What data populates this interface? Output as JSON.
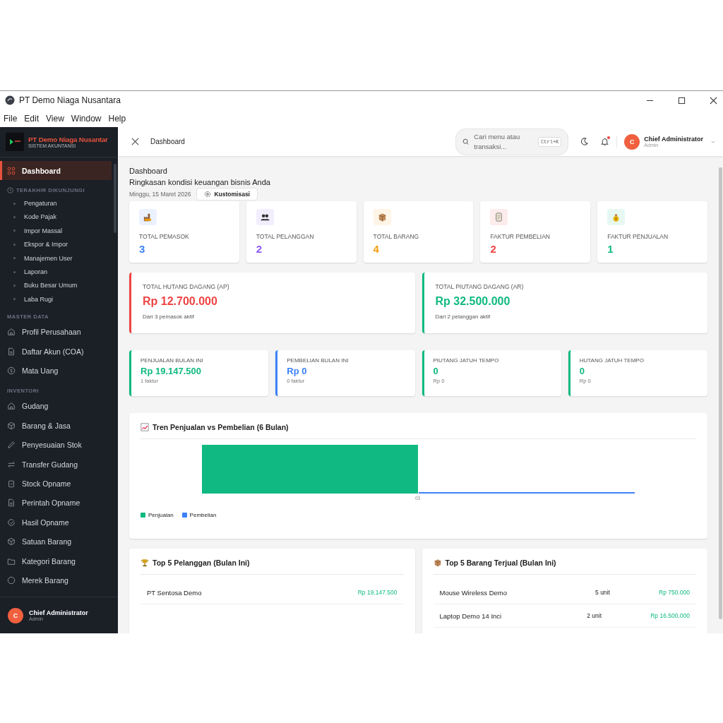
{
  "window": {
    "title": "PT Demo Niaga Nusantara"
  },
  "menu": [
    "File",
    "Edit",
    "View",
    "Window",
    "Help"
  ],
  "sidebar": {
    "brand": {
      "name": "PT Demo Niaga Nusantar",
      "subtitle": "SISTEM AKUNTANSI"
    },
    "nav": [
      {
        "kind": "item",
        "label": "Dashboard",
        "selected": true
      },
      {
        "kind": "section",
        "label": "TERAKHIR DIKUNJUNGI"
      },
      {
        "kind": "sub",
        "label": "Pengaturan",
        "selected": false
      },
      {
        "kind": "sub",
        "label": "Kode Pajak",
        "selected": false
      },
      {
        "kind": "sub",
        "label": "Impor Massal",
        "selected": false
      },
      {
        "kind": "sub",
        "label": "Ekspor & Impor",
        "selected": false
      },
      {
        "kind": "sub",
        "label": "Manajemen User",
        "selected": false
      },
      {
        "kind": "sub",
        "label": "Laporan",
        "selected": false
      },
      {
        "kind": "sub",
        "label": "Buku Besar Umum",
        "selected": false
      },
      {
        "kind": "sub",
        "label": "Laba Rugi",
        "selected": false
      },
      {
        "kind": "section",
        "label": "MASTER DATA"
      },
      {
        "kind": "item",
        "label": "Profil Perusahaan",
        "selected": false
      },
      {
        "kind": "item",
        "label": "Daftar Akun (COA)",
        "selected": false
      },
      {
        "kind": "item",
        "label": "Mata Uang",
        "selected": false
      },
      {
        "kind": "section",
        "label": "INVENTORI"
      },
      {
        "kind": "item",
        "label": "Gudang",
        "selected": false
      },
      {
        "kind": "item",
        "label": "Barang & Jasa",
        "selected": false
      },
      {
        "kind": "item",
        "label": "Penyesuaian Stok",
        "selected": false
      },
      {
        "kind": "item",
        "label": "Transfer Gudang",
        "selected": false
      },
      {
        "kind": "item",
        "label": "Stock Opname",
        "selected": false
      },
      {
        "kind": "item",
        "label": "Perintah Opname",
        "selected": false
      },
      {
        "kind": "item",
        "label": "Hasil Opname",
        "selected": false
      },
      {
        "kind": "item",
        "label": "Satuan Barang",
        "selected": false
      },
      {
        "kind": "item",
        "label": "Kategori Barang",
        "selected": false
      },
      {
        "kind": "item",
        "label": "Merek Barang",
        "selected": false
      }
    ],
    "user": {
      "initial": "C",
      "name": "Chief Administrator",
      "role": "Admin"
    }
  },
  "header": {
    "breadcrumb": "Dashboard",
    "search": {
      "placeholder": "Cari menu atau transaksi...",
      "shortcut": "Ctrl+K"
    },
    "notification_unread": true,
    "user": {
      "initial": "C",
      "name": "Chief Administrator",
      "role": "Admin"
    }
  },
  "page": {
    "title": "Dashboard",
    "subtitle": "Ringkasan kondisi keuangan bisnis Anda",
    "date": "Minggu, 15 Maret 2026",
    "customize_button": "Kustomisasi"
  },
  "stats": [
    {
      "label": "TOTAL PEMASOK",
      "value": "3",
      "color": "#3b82f6"
    },
    {
      "label": "TOTAL PELANGGAN",
      "value": "2",
      "color": "#8b5cf6"
    },
    {
      "label": "TOTAL BARANG",
      "value": "4",
      "color": "#f59e0b"
    },
    {
      "label": "FAKTUR PEMBELIAN",
      "value": "2",
      "color": "#ef4444"
    },
    {
      "label": "FAKTUR PENJUALAN",
      "value": "1",
      "color": "#10b981"
    }
  ],
  "balances": [
    {
      "label": "TOTAL HUTANG DAGANG (AP)",
      "value": "Rp 12.700.000",
      "note": "Dari 3 pemasok aktif",
      "color": "#ef4444"
    },
    {
      "label": "TOTAL PIUTANG DAGANG (AR)",
      "value": "Rp 32.500.000",
      "note": "Dari 2 pelanggan aktif",
      "color": "#10b981"
    }
  ],
  "monthly": [
    {
      "label": "PENJUALAN BULAN INI",
      "value": "Rp 19.147.500",
      "note": "1 faktur",
      "color": "#10b981"
    },
    {
      "label": "PEMBELIAN BULAN INI",
      "value": "Rp 0",
      "note": "0 faktur",
      "color": "#3b82f6"
    },
    {
      "label": "PIUTANG JATUH TEMPO",
      "value": "0",
      "note": "Rp 0",
      "color": "#10b981"
    },
    {
      "label": "HUTANG JATUH TEMPO",
      "value": "0",
      "note": "Rp 0",
      "color": "#10b981"
    }
  ],
  "trend": {
    "title": "Tren Penjualan vs Pembelian (6 Bulan)",
    "x_label": "03",
    "legend": [
      {
        "name": "Penjualan",
        "color": "#10b981"
      },
      {
        "name": "Pembelian",
        "color": "#3b82f6"
      }
    ]
  },
  "top_customers": {
    "title": "Top 5 Pelanggan (Bulan Ini)",
    "rows": [
      {
        "name": "PT Sentosa Demo",
        "amount": "Rp 19.147.500"
      }
    ]
  },
  "top_items": {
    "title": "Top 5 Barang Terjual (Bulan Ini)",
    "rows": [
      {
        "name": "Mouse Wireless Demo",
        "qty": "5 unit",
        "amount": "Rp 750.000"
      },
      {
        "name": "Laptop Demo 14 Inci",
        "qty": "2 unit",
        "amount": "Rp 16.500.000"
      }
    ]
  }
}
